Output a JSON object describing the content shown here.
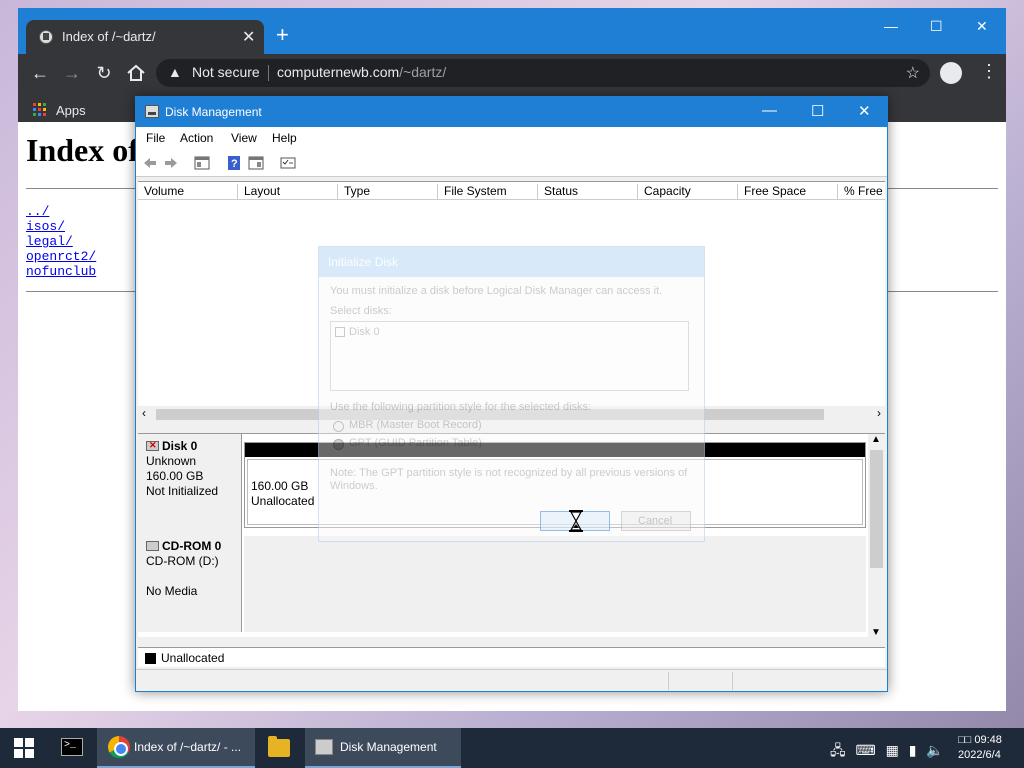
{
  "browser": {
    "tab_title": "Index of /~dartz/",
    "tab_close": "✕",
    "new_tab": "+",
    "window_controls": {
      "minimize": "—",
      "maximize": "☐",
      "close": "✕"
    },
    "security_label": "Not secure",
    "url_host": "computernewb.com",
    "url_path": "/~dartz/",
    "bookmarks_apps": "Apps",
    "icons": {
      "back": "arrow-left-icon",
      "forward": "arrow-right-icon",
      "reload": "reload-icon",
      "home": "home-icon",
      "warning": "warning-icon",
      "star": "star-icon",
      "profile": "profile-icon",
      "menu": "kebab-menu-icon"
    }
  },
  "page": {
    "heading": "Index of",
    "links": [
      "../",
      "isos/",
      "legal/",
      "openrct2/",
      "nofunclub"
    ]
  },
  "disk_mgmt": {
    "title": "Disk Management",
    "window_controls": {
      "minimize": "—",
      "maximize": "☐",
      "close": "✕"
    },
    "menu": [
      "File",
      "Action",
      "View",
      "Help"
    ],
    "columns": [
      "Volume",
      "Layout",
      "Type",
      "File System",
      "Status",
      "Capacity",
      "Free Space",
      "% Free"
    ],
    "disks": [
      {
        "name": "Disk 0",
        "type": "Unknown",
        "size": "160.00 GB",
        "state": "Not Initialized",
        "partition_size": "160.00 GB",
        "partition_state": "Unallocated"
      },
      {
        "name": "CD-ROM 0",
        "type": "CD-ROM (D:)",
        "state": "No Media"
      }
    ],
    "legend": "Unallocated"
  },
  "init_dialog": {
    "title": "Initialize Disk",
    "message": "You must initialize a disk before Logical Disk Manager can access it.",
    "select_label": "Select disks:",
    "disk_item": "Disk 0",
    "partition_label": "Use the following partition style for the selected disks:",
    "option_mbr": "MBR (Master Boot Record)",
    "option_gpt": "GPT (GUID Partition Table)",
    "selected_option": "GPT (GUID Partition Table)",
    "note": "Note: The GPT partition style is not recognized by all previous versions of",
    "note2": "Windows.",
    "ok_label": "OK",
    "cancel_label": "Cancel"
  },
  "taskbar": {
    "items": [
      {
        "label": "Index of /~dartz/ - ..."
      },
      {
        "label": "Disk Management"
      }
    ],
    "clock_time": "09:48",
    "clock_prefix": "□□",
    "clock_date": "2022/6/4"
  },
  "colors": {
    "titlebar_blue": "#1f7fd4",
    "chrome_dark": "#35363a",
    "taskbar": "#1e2a3a",
    "unallocated": "#000000"
  }
}
